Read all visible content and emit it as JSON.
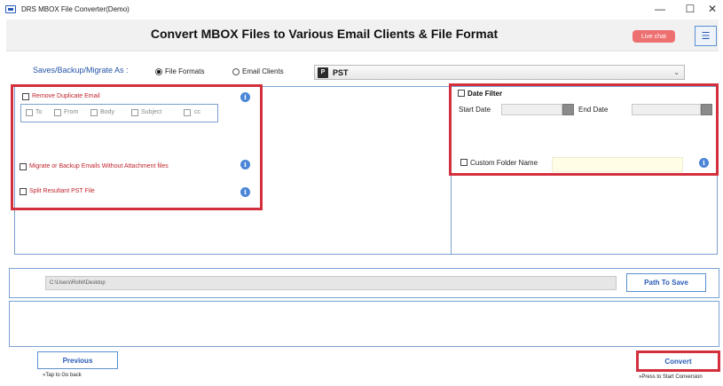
{
  "window": {
    "title": "DRS MBOX File Converter(Demo)",
    "controls": {
      "minimize": "—",
      "maximize": "☐",
      "close": "✕"
    }
  },
  "header": {
    "title": "Convert MBOX Files to Various Email Clients & File Format",
    "live_chat": "Live chat",
    "menu_icon": "☰"
  },
  "save_as": {
    "label": "Saves/Backup/Migrate As :",
    "options": [
      "File Formats",
      "Email Clients"
    ],
    "selected_option": "File Formats",
    "format_icon": "P",
    "format_value": "PST",
    "dropdown_arrow": "⌄"
  },
  "options": {
    "remove_duplicate": "Remove Duplicate Email",
    "duplicate_fields": [
      "To",
      "From",
      "Body",
      "Subject",
      "cc"
    ],
    "without_attachment": "Migrate or Backup Emails Without Attachment files",
    "split_pst": "Split Resultant PST File",
    "info_glyph": "i"
  },
  "date_filter": {
    "label": "Date Filter",
    "start_label": "Start Date",
    "end_label": "End Date"
  },
  "custom_folder": {
    "label": "Custom Folder Name"
  },
  "path": {
    "value": "C:\\Users\\Rohit\\Desktop",
    "button": "Path To Save"
  },
  "footer": {
    "previous": "Previous",
    "previous_hint": "»Tap to Go back",
    "convert": "Convert",
    "convert_hint": "»Press to Start Conversion"
  },
  "colors": {
    "highlight_box": "#d32f3c",
    "accent_blue": "#2a5bb8",
    "option_red": "#c0262d",
    "live_chat": "#ee6f6f"
  }
}
